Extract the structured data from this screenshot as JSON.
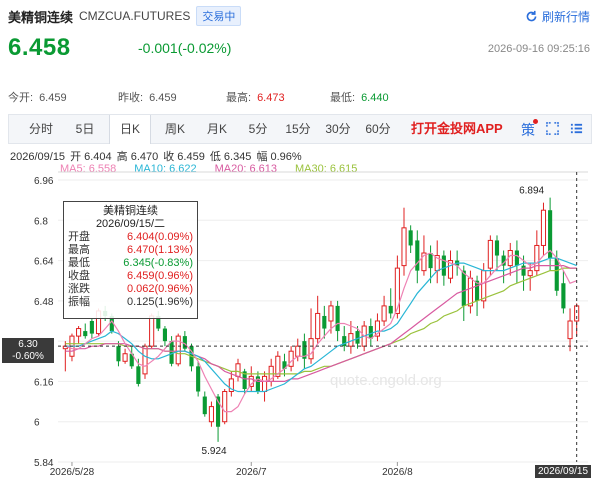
{
  "header": {
    "name": "美精铜连续",
    "code": "CMZCUA.FUTURES",
    "status": "交易中",
    "refresh_label": "刷新行情",
    "price": "6.458",
    "change": "-0.001(-0.02%)",
    "timestamp": "2026-09-16 09:25:16"
  },
  "quote": {
    "today_open_label": "今开:",
    "today_open": "6.459",
    "prev_close_label": "昨收:",
    "prev_close": "6.459",
    "high_label": "最高:",
    "high": "6.473",
    "low_label": "最低:",
    "low": "6.440"
  },
  "toolbar": {
    "tabs": [
      "分时",
      "5日",
      "日K",
      "周K",
      "月K",
      "5分",
      "15分",
      "30分",
      "60分"
    ],
    "active": "日K",
    "app_link": "打开金投网APP",
    "strategy_label": "策",
    "icons": [
      "strategy-icon",
      "fullscreen-icon",
      "settings-icon"
    ]
  },
  "ohlc_line": {
    "date": "2026/09/15",
    "open": "开 6.404",
    "high": "高 6.470",
    "close": "收 6.459",
    "low": "低 6.345",
    "amp": "幅 0.96%"
  },
  "ma_line": {
    "ma5": "MA5: 6.558",
    "ma10": "MA10: 6.622",
    "ma20": "MA20: 6.613",
    "ma30": "MA30: 6.615"
  },
  "tooltip": {
    "title": "美精铜连续",
    "date": "2026/09/15/二",
    "rows": [
      {
        "label": "开盘",
        "value": "6.404(0.09%)"
      },
      {
        "label": "最高",
        "value": "6.470(1.13%)"
      },
      {
        "label": "最低",
        "value": "6.345(-0.83%)"
      },
      {
        "label": "收盘",
        "value": "6.459(0.96%)"
      },
      {
        "label": "涨跌",
        "value": "0.062(0.96%)"
      },
      {
        "label": "振幅",
        "value": "0.125(1.96%)"
      }
    ]
  },
  "crosshair": {
    "price": "6.30",
    "pct": "-0.60%",
    "date": "2026/09/15"
  },
  "watermark": "quote.cngold.org",
  "colors": {
    "up": "#e02020",
    "down": "#0a9a33",
    "accent": "#2a6edb",
    "ma5": "#ee82b4",
    "ma10": "#29b6d6",
    "ma20": "#d85aa0",
    "ma30": "#9ac23c"
  },
  "chart_data": {
    "type": "candlestick",
    "ylim": [
      5.84,
      6.96
    ],
    "yticks": [
      "6.96",
      "6.8",
      "6.64",
      "6.48",
      "6.32",
      "6.16",
      "6",
      "5.84"
    ],
    "xticks": [
      "2026/5/28",
      "2026/7",
      "2026/8"
    ],
    "annotations": [
      {
        "label": "6.894"
      },
      {
        "label": "5.924"
      }
    ],
    "candles": [
      [
        6.29,
        6.3,
        6.2,
        6.32
      ],
      [
        6.26,
        6.34,
        6.24,
        6.35
      ],
      [
        6.34,
        6.37,
        6.31,
        6.38
      ],
      [
        6.36,
        6.34,
        6.33,
        6.39
      ],
      [
        6.4,
        6.35,
        6.33,
        6.41
      ],
      [
        6.35,
        6.44,
        6.34,
        6.45
      ],
      [
        6.44,
        6.42,
        6.4,
        6.46
      ],
      [
        6.42,
        6.36,
        6.35,
        6.43
      ],
      [
        6.3,
        6.24,
        6.22,
        6.32
      ],
      [
        6.24,
        6.27,
        6.23,
        6.29
      ],
      [
        6.27,
        6.22,
        6.21,
        6.3
      ],
      [
        6.22,
        6.15,
        6.14,
        6.25
      ],
      [
        6.19,
        6.3,
        6.17,
        6.31
      ],
      [
        6.3,
        6.42,
        6.29,
        6.43
      ],
      [
        6.42,
        6.37,
        6.36,
        6.44
      ],
      [
        6.37,
        6.32,
        6.3,
        6.38
      ],
      [
        6.32,
        6.23,
        6.22,
        6.34
      ],
      [
        6.23,
        6.34,
        6.22,
        6.35
      ],
      [
        6.34,
        6.29,
        6.28,
        6.36
      ],
      [
        6.3,
        6.22,
        6.2,
        6.31
      ],
      [
        6.22,
        6.12,
        6.1,
        6.24
      ],
      [
        6.1,
        6.03,
        6.02,
        6.12
      ],
      [
        6.0,
        6.06,
        5.98,
        6.08
      ],
      [
        6.1,
        5.98,
        5.92,
        6.11
      ],
      [
        6.0,
        6.12,
        5.99,
        6.13
      ],
      [
        6.12,
        6.17,
        6.1,
        6.2
      ],
      [
        6.18,
        6.23,
        6.16,
        6.25
      ],
      [
        6.2,
        6.13,
        6.11,
        6.21
      ],
      [
        6.14,
        6.18,
        6.12,
        6.22
      ],
      [
        6.18,
        6.12,
        6.11,
        6.2
      ],
      [
        6.12,
        6.18,
        6.08,
        6.2
      ],
      [
        6.16,
        6.22,
        6.14,
        6.25
      ],
      [
        6.18,
        6.26,
        6.17,
        6.28
      ],
      [
        6.24,
        6.21,
        6.18,
        6.27
      ],
      [
        6.22,
        6.28,
        6.2,
        6.3
      ],
      [
        6.26,
        6.3,
        6.24,
        6.33
      ],
      [
        6.32,
        6.25,
        6.21,
        6.35
      ],
      [
        6.25,
        6.33,
        6.23,
        6.45
      ],
      [
        6.33,
        6.43,
        6.31,
        6.5
      ],
      [
        6.42,
        6.37,
        6.33,
        6.46
      ],
      [
        6.4,
        6.46,
        6.35,
        6.48
      ],
      [
        6.46,
        6.36,
        6.32,
        6.48
      ],
      [
        6.34,
        6.3,
        6.28,
        6.38
      ],
      [
        6.3,
        6.35,
        6.27,
        6.4
      ],
      [
        6.36,
        6.31,
        6.29,
        6.38
      ],
      [
        6.3,
        6.38,
        6.28,
        6.4
      ],
      [
        6.38,
        6.33,
        6.3,
        6.41
      ],
      [
        6.34,
        6.4,
        6.32,
        6.43
      ],
      [
        6.4,
        6.46,
        6.38,
        6.5
      ],
      [
        6.46,
        6.43,
        6.41,
        6.53
      ],
      [
        6.43,
        6.61,
        6.41,
        6.66
      ],
      [
        6.62,
        6.77,
        6.58,
        6.85
      ],
      [
        6.76,
        6.7,
        6.67,
        6.78
      ],
      [
        6.72,
        6.6,
        6.55,
        6.76
      ],
      [
        6.6,
        6.67,
        6.58,
        6.74
      ],
      [
        6.67,
        6.61,
        6.55,
        6.7
      ],
      [
        6.6,
        6.66,
        6.55,
        6.72
      ],
      [
        6.66,
        6.58,
        6.54,
        6.68
      ],
      [
        6.57,
        6.64,
        6.55,
        6.68
      ],
      [
        6.64,
        6.62,
        6.58,
        6.68
      ],
      [
        6.6,
        6.46,
        6.4,
        6.62
      ],
      [
        6.46,
        6.57,
        6.43,
        6.6
      ],
      [
        6.56,
        6.48,
        6.42,
        6.58
      ],
      [
        6.48,
        6.6,
        6.45,
        6.63
      ],
      [
        6.61,
        6.72,
        6.58,
        6.74
      ],
      [
        6.72,
        6.66,
        6.6,
        6.74
      ],
      [
        6.66,
        6.62,
        6.55,
        6.68
      ],
      [
        6.62,
        6.68,
        6.58,
        6.71
      ],
      [
        6.68,
        6.62,
        6.55,
        6.72
      ],
      [
        6.62,
        6.58,
        6.52,
        6.66
      ],
      [
        6.58,
        6.6,
        6.52,
        6.63
      ],
      [
        6.6,
        6.7,
        6.58,
        6.76
      ],
      [
        6.7,
        6.84,
        6.66,
        6.87
      ],
      [
        6.84,
        6.65,
        6.6,
        6.89
      ],
      [
        6.65,
        6.52,
        6.5,
        6.68
      ],
      [
        6.55,
        6.45,
        6.43,
        6.6
      ],
      [
        6.33,
        6.4,
        6.28,
        6.45
      ],
      [
        6.4,
        6.46,
        6.34,
        6.47
      ]
    ],
    "ma5": [
      6.3,
      6.29,
      6.29,
      6.31,
      6.33,
      6.34,
      6.37,
      6.4,
      6.36,
      6.31,
      6.27,
      6.23,
      6.22,
      6.24,
      6.26,
      6.29,
      6.32,
      6.32,
      6.31,
      6.28,
      6.24,
      6.18,
      6.13,
      6.08,
      6.04,
      6.04,
      6.06,
      6.11,
      6.15,
      6.17,
      6.16,
      6.17,
      6.19,
      6.21,
      6.24,
      6.26,
      6.26,
      6.27,
      6.31,
      6.34,
      6.37,
      6.39,
      6.39,
      6.38,
      6.37,
      6.34,
      6.33,
      6.35,
      6.37,
      6.39,
      6.45,
      6.53,
      6.6,
      6.63,
      6.66,
      6.67,
      6.65,
      6.64,
      6.63,
      6.62,
      6.59,
      6.57,
      6.55,
      6.55,
      6.58,
      6.61,
      6.63,
      6.66,
      6.66,
      6.64,
      6.62,
      6.63,
      6.66,
      6.68,
      6.65,
      6.6,
      6.55,
      6.56
    ],
    "ma10": [
      6.3,
      6.3,
      6.3,
      6.31,
      6.32,
      6.33,
      6.34,
      6.36,
      6.35,
      6.33,
      6.31,
      6.28,
      6.26,
      6.25,
      6.25,
      6.26,
      6.27,
      6.28,
      6.28,
      6.27,
      6.26,
      6.24,
      6.21,
      6.18,
      6.15,
      6.13,
      6.12,
      6.12,
      6.12,
      6.12,
      6.12,
      6.13,
      6.14,
      6.15,
      6.17,
      6.19,
      6.21,
      6.22,
      6.24,
      6.26,
      6.28,
      6.3,
      6.31,
      6.32,
      6.33,
      6.34,
      6.35,
      6.36,
      6.36,
      6.37,
      6.39,
      6.43,
      6.47,
      6.51,
      6.54,
      6.57,
      6.6,
      6.61,
      6.62,
      6.63,
      6.63,
      6.62,
      6.61,
      6.6,
      6.6,
      6.6,
      6.6,
      6.61,
      6.62,
      6.63,
      6.63,
      6.63,
      6.64,
      6.65,
      6.65,
      6.64,
      6.63,
      6.62
    ],
    "ma20": [
      6.28,
      6.28,
      6.29,
      6.29,
      6.3,
      6.3,
      6.31,
      6.31,
      6.31,
      6.31,
      6.3,
      6.3,
      6.29,
      6.29,
      6.29,
      6.28,
      6.28,
      6.28,
      6.28,
      6.27,
      6.26,
      6.25,
      6.23,
      6.22,
      6.2,
      6.19,
      6.18,
      6.17,
      6.17,
      6.16,
      6.16,
      6.16,
      6.16,
      6.16,
      6.17,
      6.17,
      6.18,
      6.19,
      6.2,
      6.21,
      6.22,
      6.23,
      6.24,
      6.25,
      6.26,
      6.27,
      6.28,
      6.29,
      6.3,
      6.31,
      6.33,
      6.35,
      6.37,
      6.39,
      6.41,
      6.43,
      6.45,
      6.47,
      6.49,
      6.51,
      6.52,
      6.53,
      6.54,
      6.55,
      6.56,
      6.57,
      6.58,
      6.59,
      6.6,
      6.61,
      6.61,
      6.62,
      6.62,
      6.62,
      6.62,
      6.62,
      6.61,
      6.61
    ],
    "ma30": [
      6.31,
      6.31,
      6.31,
      6.31,
      6.31,
      6.31,
      6.31,
      6.31,
      6.31,
      6.3,
      6.3,
      6.3,
      6.29,
      6.29,
      6.29,
      6.28,
      6.28,
      6.27,
      6.27,
      6.26,
      6.25,
      6.24,
      6.23,
      6.22,
      6.21,
      6.2,
      6.2,
      6.19,
      6.19,
      6.19,
      6.19,
      6.19,
      6.19,
      6.19,
      6.19,
      6.19,
      6.2,
      6.2,
      6.21,
      6.22,
      6.22,
      6.23,
      6.24,
      6.25,
      6.26,
      6.27,
      6.28,
      6.29,
      6.3,
      6.31,
      6.32,
      6.33,
      6.35,
      6.36,
      6.37,
      6.39,
      6.4,
      6.42,
      6.43,
      6.44,
      6.46,
      6.47,
      6.48,
      6.49,
      6.5,
      6.51,
      6.52,
      6.54,
      6.55,
      6.56,
      6.57,
      6.58,
      6.59,
      6.6,
      6.6,
      6.61,
      6.61,
      6.61
    ]
  }
}
